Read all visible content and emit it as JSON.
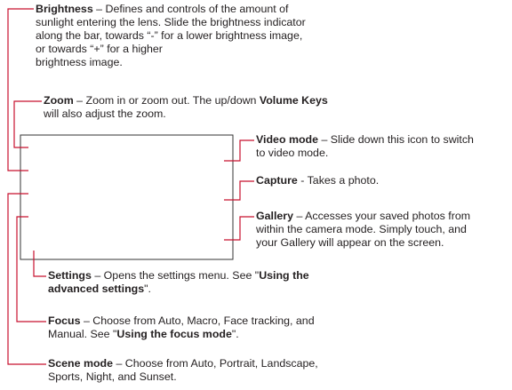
{
  "accent_color": "#c8102e",
  "callouts": {
    "brightness": {
      "term": "Brightness",
      "description": " – Defines and controls of the amount of\nsunlight entering the lens. Slide the brightness indicator\nalong the bar, towards “-” for a lower brightness image,\nor towards “+” for a higher\nbrightness image."
    },
    "zoom": {
      "term": "Zoom",
      "description_1": " – Zoom in or zoom out. The up/down ",
      "keys_term": "Volume Keys",
      "description_2": "\nwill also adjust the zoom."
    },
    "video_mode": {
      "term": "Video mode",
      "description": " – Slide down this icon to switch\nto video mode."
    },
    "capture": {
      "term": "Capture",
      "description": " - Takes a photo."
    },
    "gallery": {
      "term": "Gallery",
      "description": " – Accesses your saved photos from\nwithin the camera mode. Simply touch, and\nyour Gallery will appear on the screen."
    },
    "settings": {
      "term": "Settings",
      "description": " – Opens the settings menu. See \"",
      "link": "Using the\nadvanced settings",
      "suffix": "\"."
    },
    "focus": {
      "term": "Focus",
      "description": " – Choose from Auto, Macro, Face tracking, and\nManual. See \"",
      "link": "Using the focus mode",
      "suffix": "\"."
    },
    "scene_mode": {
      "term": "Scene mode",
      "description": " – Choose from Auto, Portrait, Landscape,\nSports, Night, and Sunset."
    }
  }
}
